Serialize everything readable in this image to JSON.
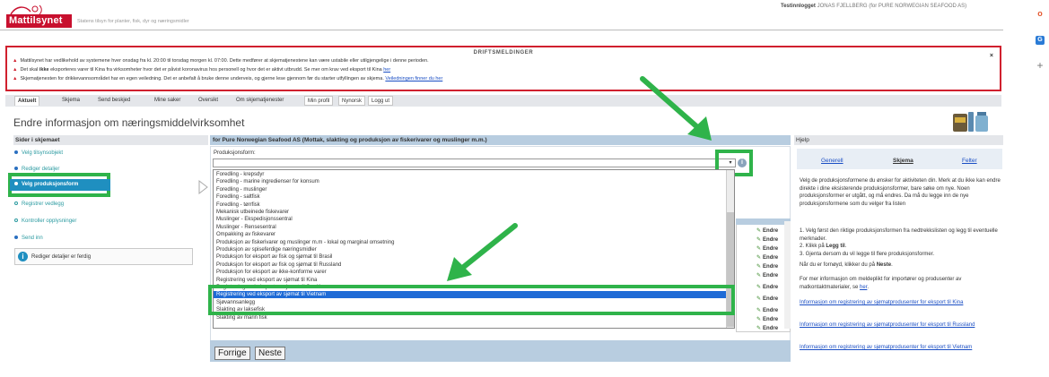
{
  "header": {
    "logo": "Mattilsynet",
    "tagline": "Statens tilsyn for planter, fisk, dyr og næringsmidler",
    "login_label": "Testinnlogget",
    "login_user": "JONAS FJELLBERG (for PURE NORWEGIAN SEAFOOD AS)"
  },
  "drift": {
    "title": "DRIFTSMELDINGER",
    "line1": "Mattilsynet har vedlikehold av systemene hver onsdag fra kl. 20:00 til torsdag morgen kl. 07:00. Dette medfører at skjematjenestene kan være ustabile eller utilgjengelige i denne perioden.",
    "line2_pre": "Det skal",
    "line2_bold": "ikke",
    "line2_post": "eksporteres varer til Kina fra virksomheter hvor det er påvist koronavirus hos personell og hvor det er aktivt utbrudd. Se mer om krav ved eksport til Kina",
    "line2_link": "her",
    "line3_pre": "Skjematjenesten for drikkevannsområdet har en egen veiledning. Det er anbefalt å bruke denne underveis, og gjerne lese gjennom før du starter utfyllingen av skjema.",
    "line3_link": "Veiledningen finner du her",
    "close": "×"
  },
  "nav": {
    "tabs": [
      "Aktuelt",
      "Skjema",
      "Send beskjed",
      "Mine saker",
      "Oversikt",
      "Om skjematjenester",
      "Min profil",
      "Nynorsk",
      "Logg ut"
    ]
  },
  "page": {
    "title": "Endre informasjon om næringsmiddelvirksomhet"
  },
  "sidebar": {
    "header": "Sider i skjemaet",
    "items": [
      "Velg tilsynsobjekt",
      "Rediger detaljer",
      "Velg produksjonsform",
      "Registrer vedlegg",
      "Kontroller opplysninger",
      "Send inn"
    ],
    "info": "Rediger detaljer er ferdig"
  },
  "center": {
    "header": "for Pure Norwegian Seafood AS (Mottak, slakting og produksjon av fiskerivarer og muslinger m.m.)",
    "field_label": "Produksjonsform:",
    "dropdown_arrow": "▾",
    "info_icon": "i",
    "options": [
      "Foredling - krepsdyr",
      "Foredling - marine ingredienser for konsum",
      "Foredling - muslinger",
      "Foredling - saltfisk",
      "Foredling - tørrfisk",
      "Mekanisk utbeinede fiskevarer",
      "Muslinger - Ekspedisjonssentral",
      "Muslinger - Rensesentral",
      "Ompakking av fiskevarer",
      "Produksjon av fiskerivarer og muslinger m.m - lokal og marginal omsetning",
      "Produksjon av spiseferdige næringsmidler",
      "Produksjon for eksport av fisk og sjømat til Brasil",
      "Produksjon for eksport av fisk og sjømat til Russland",
      "Produksjon for eksport av ikke-konforme varer",
      "Registrering ved eksport av sjømat til Kina",
      "Registrering ved eksport av sjømat til Sør-Korea",
      "Registrering ved eksport av sjømat til Vietnam",
      "Sjøvannsanlegg",
      "Slakting av laksefisk",
      "Slakting av marin fisk"
    ],
    "selected_index": 16,
    "endre_label": "Endre",
    "buttons": {
      "back": "Forrige",
      "next": "Neste"
    }
  },
  "help": {
    "header": "Hjelp",
    "tabs": [
      "Generell",
      "Skjema",
      "Felter"
    ],
    "p1": "Velg de produksjonsformene du ønsker for aktiviteten din. Merk at du ikke kan endre direkte i dine eksisterende produksjonsformer, bare søke om nye. Noen produksjonsformer er utgått, og må endres. Da må du legge inn de nye produksjonsformene som du velger fra listen",
    "p2_1": "1. Velg først den riktige produksjonsformen fra nedtrekkslisten og legg til eventuelle merknader.",
    "p2_2_pre": "2. Klikk på",
    "p2_2_bold": "Legg til",
    "p2_3": "3. Gjenta dersom du vil legge til flere produksjonsformer.",
    "p3_pre": "Når du er fornøyd, klikker du på",
    "p3_bold": "Neste",
    "p4_pre": "For mer informasjon om meldeplikt for importører og produsenter av matkontaktmaterialer, se",
    "p4_link": "her",
    "link1": "Informasjon om registrering av sjømatprodusenter for eksport til Kina",
    "link2": "Informasjon om registrering av sjømatprodusenter for eksport til Russland",
    "link3": "Informasjon om registrering av sjømatprodusenter for eksport til Vietnam"
  },
  "colors": {
    "brand": "#c8102e",
    "highlight": "#2fb34a",
    "selected": "#1f6bd6"
  }
}
